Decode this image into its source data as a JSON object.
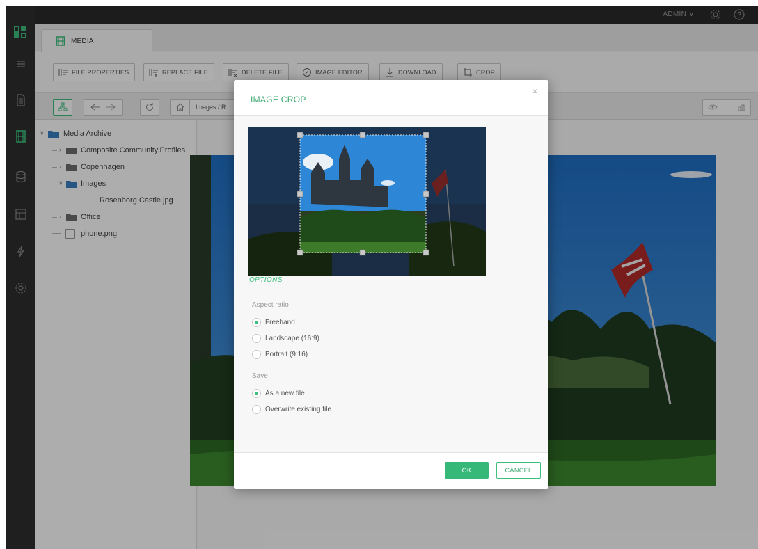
{
  "topbar": {
    "user": "ADMIN",
    "user_caret": "∨"
  },
  "tab": {
    "label": "MEDIA"
  },
  "toolbar": {
    "file_properties": "FILE PROPERTIES",
    "replace_file": "REPLACE FILE",
    "delete_file": "DELETE FILE",
    "image_editor": "IMAGE EDITOR",
    "download": "DOWNLOAD",
    "crop": "CROP"
  },
  "address": {
    "breadcrumb": "Images / R"
  },
  "tree": {
    "root": "Media Archive",
    "items": [
      {
        "label": "Composite.Community.Profiles",
        "type": "folder"
      },
      {
        "label": "Copenhagen",
        "type": "folder"
      },
      {
        "label": "Images",
        "type": "folder-open"
      },
      {
        "label": "Rosenborg Castle.jpg",
        "type": "image"
      },
      {
        "label": "Office",
        "type": "folder"
      },
      {
        "label": "phone.png",
        "type": "image"
      }
    ]
  },
  "modal": {
    "title": "IMAGE CROP",
    "close": "×",
    "options": "OPTIONS",
    "aspect_label": "Aspect ratio",
    "aspect_options": [
      "Freehand",
      "Landscape (16:9)",
      "Portrait (9:16)"
    ],
    "aspect_selected": "Freehand",
    "save_label": "Save",
    "save_options": [
      "As a new file",
      "Overwrite existing file"
    ],
    "save_selected": "As a new file",
    "ok": "OK",
    "cancel": "CANCEL"
  },
  "colors": {
    "accent": "#3dbf7e",
    "rail": "#2f2f2f",
    "topbar": "#2a2a2a"
  }
}
